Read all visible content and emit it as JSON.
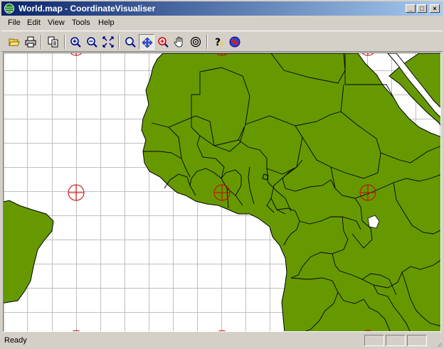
{
  "window": {
    "title": "World.map - CoordinateVisualiser"
  },
  "menu": {
    "items": [
      "File",
      "Edit",
      "View",
      "Tools",
      "Help"
    ]
  },
  "toolbar": {
    "buttons": [
      {
        "name": "open-button",
        "icon": "folder-open-icon"
      },
      {
        "name": "print-button",
        "icon": "printer-icon"
      },
      {
        "name": "copy-button",
        "icon": "copy-icon"
      },
      {
        "name": "zoom-in-button",
        "icon": "zoom-in-icon"
      },
      {
        "name": "zoom-out-button",
        "icon": "zoom-out-icon"
      },
      {
        "name": "zoom-extents-button",
        "icon": "fit-extents-icon"
      },
      {
        "name": "zoom-tool-button",
        "icon": "magnifier-icon"
      },
      {
        "name": "pan-move-button",
        "icon": "move-arrows-icon",
        "active": true
      },
      {
        "name": "zoom-window-button",
        "icon": "zoom-target-icon"
      },
      {
        "name": "hand-pan-button",
        "icon": "hand-icon"
      },
      {
        "name": "center-target-button",
        "icon": "target-icon"
      },
      {
        "name": "help-button",
        "icon": "help-question-icon"
      },
      {
        "name": "about-button",
        "icon": "globe-icon"
      }
    ]
  },
  "map": {
    "colors": {
      "land": "#669900",
      "grid": "#bfbfbf",
      "marker": "#cc0000",
      "ocean": "#ffffff"
    }
  },
  "status": {
    "text": "Ready"
  }
}
